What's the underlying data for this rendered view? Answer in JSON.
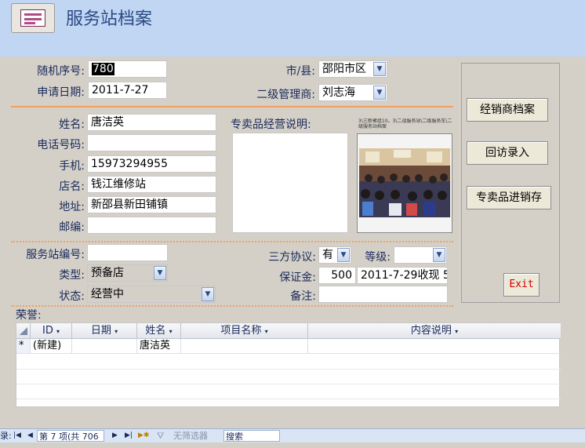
{
  "header": {
    "title": "服务站档案",
    "icon": "form-icon"
  },
  "fields": {
    "random_no": {
      "label": "随机序号:",
      "value": "780"
    },
    "city": {
      "label": "市/县:",
      "value": "邵阳市区"
    },
    "apply_date": {
      "label": "申请日期:",
      "value": "2011-7-27"
    },
    "manager": {
      "label": "二级管理商:",
      "value": "刘志海"
    },
    "name": {
      "label": "姓名:",
      "value": "唐洁英"
    },
    "phone": {
      "label": "电话号码:",
      "value": ""
    },
    "mobile": {
      "label": "手机:",
      "value": "15973294955"
    },
    "shop": {
      "label": "店名:",
      "value": "钱江维修站"
    },
    "address": {
      "label": "地址:",
      "value": "新邵县新田铺镇"
    },
    "postcode": {
      "label": "邮编:",
      "value": ""
    },
    "special_desc": {
      "label": "专卖品经营说明:",
      "value": ""
    },
    "photo_caption": "3\\三新聚组10。3\\二战服务站\\二级服务车\\二级服务站档案",
    "station_no": {
      "label": "服务站编号:",
      "value": ""
    },
    "tripartite": {
      "label": "三方协议:",
      "value": "有"
    },
    "grade": {
      "label": "等级:",
      "value": ""
    },
    "type": {
      "label": "类型:",
      "value": "预备店"
    },
    "deposit": {
      "label": "保证金:",
      "amount": "500",
      "note": "2011-7-29收现 5"
    },
    "status": {
      "label": "状态:",
      "value": "经营中"
    },
    "remark": {
      "label": "备注:",
      "value": ""
    },
    "honor": {
      "label": "荣誉:"
    }
  },
  "buttons": {
    "dealer_archive": "经销商档案",
    "visit_entry": "回访录入",
    "special_inventory": "专卖品进销存",
    "exit": "Exit"
  },
  "grid": {
    "columns": [
      "ID",
      "日期",
      "姓名",
      "项目名称",
      "内容说明"
    ],
    "new_row": {
      "marker": "*",
      "id": "(新建)",
      "name": "唐洁英"
    }
  },
  "navbar": {
    "prefix": "录:",
    "record": "第 7 项(共 706",
    "filter": "无筛选器",
    "search": "搜索"
  },
  "colors": {
    "header_bg": "#c0d6f2",
    "form_bg": "#d4d0c8",
    "separator": "#f0a060",
    "exit_text": "#cc0000"
  }
}
